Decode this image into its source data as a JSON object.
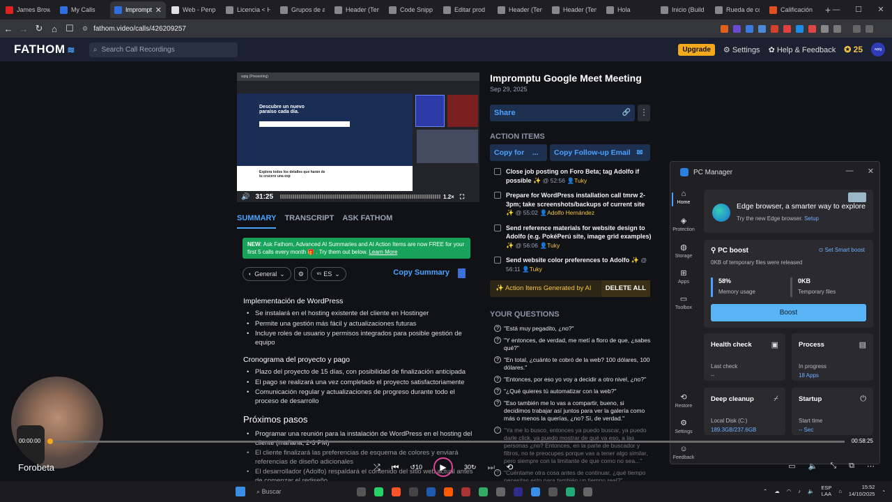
{
  "browser": {
    "tabs": [
      {
        "label": "James Brow",
        "favicon": "#e02020"
      },
      {
        "label": "My Calls",
        "favicon": "#2d6fe0"
      },
      {
        "label": "Imprompt",
        "favicon": "#2d6fe0"
      },
      {
        "label": "Web - Penp",
        "favicon": "#e0e0e0"
      },
      {
        "label": "Licencia < H",
        "favicon": "#888888"
      },
      {
        "label": "Grupos de a",
        "favicon": "#888888"
      },
      {
        "label": "Header (Tem",
        "favicon": "#888888"
      },
      {
        "label": "Code Snipp",
        "favicon": "#888888"
      },
      {
        "label": "Editar prod",
        "favicon": "#888888"
      },
      {
        "label": "Header (Tem",
        "favicon": "#888888"
      },
      {
        "label": "Header (Tem",
        "favicon": "#888888"
      },
      {
        "label": "Hola",
        "favicon": "#888888"
      },
      {
        "label": "Inicio (Build",
        "favicon": "#888888"
      },
      {
        "label": "Rueda de co",
        "favicon": "#888888"
      },
      {
        "label": "Calificación",
        "favicon": "#e05020"
      }
    ],
    "active_tab_close": "✕",
    "new_tab": "+",
    "url": "fathom.video/calls/426209257"
  },
  "header": {
    "logo": "FATHOM",
    "search_placeholder": "Search Call Recordings",
    "upgrade": "Upgrade",
    "settings": "Settings",
    "help": "Help & Feedback",
    "coins": "25",
    "avatar": "wpig"
  },
  "video": {
    "top_label": "wpig (Presenting)",
    "hero_line1": "Descubre un nuevo",
    "hero_line2": "paraíso cada día.",
    "low_text": "Explora todos los detalles que harán de tu crucero una exp",
    "time": "31:25",
    "speed": "1.2×"
  },
  "summary_tabs": [
    "SUMMARY",
    "TRANSCRIPT",
    "ASK FATHOM"
  ],
  "promo": {
    "new": "NEW",
    "text": ": Ask Fathom, Advanced AI Summaries and AI Action Items are now FREE for your first 5 calls every month 🎁 . Try them out below.",
    "link": "Learn More"
  },
  "toolbar": {
    "template": "General",
    "language": "ES",
    "copy_summary": "Copy Summary"
  },
  "summary": {
    "sections": [
      {
        "title": "Implementación de WordPress",
        "items": [
          "Se instalará en el hosting existente del cliente en Hostinger",
          "Permite una gestión más fácil y actualizaciones futuras",
          "Incluye roles de usuario y permisos integrados para posible gestión de equipo"
        ]
      },
      {
        "title": "Cronograma del proyecto y pago",
        "items": [
          "Plazo del proyecto de 15 días, con posibilidad de finalización anticipada",
          "El pago se realizará una vez completado el proyecto satisfactoriamente",
          "Comunicación regular y actualizaciones de progreso durante todo el proceso de desarrollo"
        ]
      }
    ],
    "next_title": "Próximos pasos",
    "next_items": [
      "Programar una reunión para la instalación de WordPress en el hosting del cliente (mañana, 2-3 PM)",
      "El cliente finalizará las preferencias de esquema de colores y enviará referencias de diseño adicionales",
      "El desarrollador (Adolfo) respaldará el contenido del sitio web actual antes de comenzar el rediseño"
    ]
  },
  "meeting": {
    "title": "Impromptu Google Meet Meeting",
    "date": "Sep 29, 2025",
    "share": "Share",
    "action_items_heading": "ACTION ITEMS",
    "copy_for": "Copy for",
    "copy_for_suffix": "...",
    "copy_followup": "Copy Follow-up Email",
    "action_items": [
      {
        "text": "Close job posting on Foro Beta; tag Adolfo if possible ✨",
        "time": "@ 52:56",
        "who": "Tuky"
      },
      {
        "text": "Prepare for WordPress installation call tmrw 2-3pm; take screenshots/backups of current site ✨",
        "time": "@ 55:02",
        "who": "Adolfo Hernández"
      },
      {
        "text": "Send reference materials for website design to Adolfo (e.g. PokéPerú site, image grid examples) ✨",
        "time": "@ 56:06",
        "who": "Tuky"
      },
      {
        "text": "Send website color preferences to Adolfo ✨",
        "time": "@ 56:11",
        "who": "Tuky"
      }
    ],
    "ai_generated": "✨ Action Items Generated by AI",
    "delete_all": "DELETE ALL",
    "questions_heading": "YOUR QUESTIONS",
    "questions": [
      "\"Está muy pegadito, ¿no?\"",
      "\"Y entonces, de verdad, me metí a floro de que, ¿sabes qué?\"",
      "\"En total, ¿cuánto te cobró de la web? 100 dólares, 100 dólares.\"",
      "\"Entonces, por eso yo voy a decidir a otro nivel, ¿no?\"",
      "\"¿Qué quieres tú automatizar con la web?\"",
      "\"Eso también me lo vas a compartir, bueno, si decidimos trabajar así juntos para ver la galería como más o menos la querías, ¿no? Sí, de verdad.\"",
      "\"Ya me lo busco, entonces ya puedo buscar, ya puedo darle click, ya puedo mostrar de qué va eso, a las personas ¿no? Entonces, en la parte de buscador y filtros, no te preocupes porque vas a tener algo similar, pero siempre con la limitante de que como no sea...\"",
      "\"Cuéntame otra cosa antes de continuar, ¿qué tiempo necesitas esto para también un tiempo real?\""
    ]
  },
  "pc_manager": {
    "title": "PC Manager",
    "nav": [
      "Home",
      "Protection",
      "Storage",
      "Apps",
      "Toolbox",
      "Restore",
      "Settings",
      "Feedback"
    ],
    "edge_title": "Edge browser, a smarter way to explore",
    "edge_sub": "Try the new Edge browser.",
    "edge_link": "Setup",
    "boost_title": "PC boost",
    "smart_boost": "Set Smart boost",
    "released": "0KB of temporary files were released",
    "memory_value": "58%",
    "memory_label": "Memory usage",
    "temp_value": "0KB",
    "temp_label": "Temporary files",
    "boost_btn": "Boost",
    "health_title": "Health check",
    "health_l1": "Last check",
    "health_l2": "--",
    "process_title": "Process",
    "process_l1": "In progress",
    "process_l2": "18 Apps",
    "cleanup_title": "Deep cleanup",
    "cleanup_l1": "Local Disk (C:)",
    "cleanup_l2": "189.3GB/237.6GB",
    "startup_title": "Startup",
    "startup_l1": "Start time",
    "startup_l2": "-- Sec"
  },
  "player": {
    "current": "00:00:00",
    "total": "00:58:25",
    "progress": 0.0,
    "webcam_name": "Forobeta"
  },
  "taskbar": {
    "search": "Buscar",
    "lang1": "ESP",
    "lang2": "LAA",
    "time": "15:52",
    "date": "14/10/2025"
  }
}
